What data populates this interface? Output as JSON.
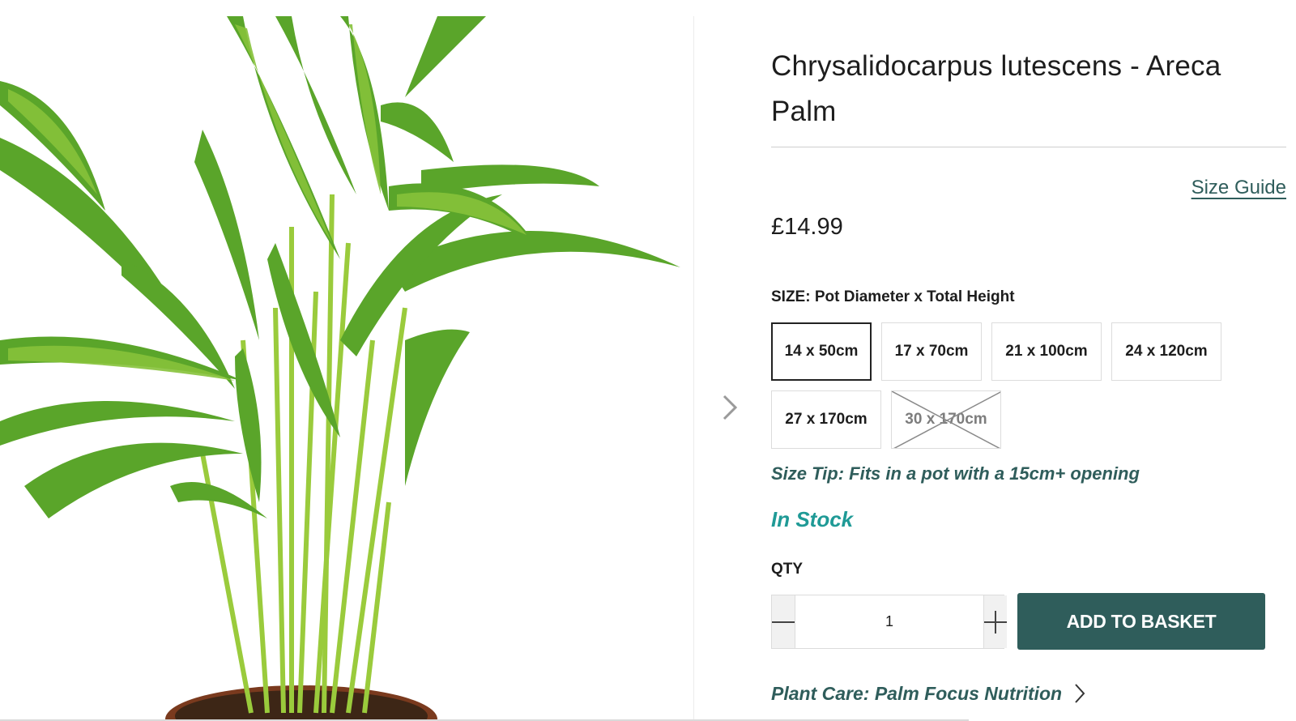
{
  "product": {
    "title": "Chrysalidocarpus lutescens - Areca Palm",
    "price": "£14.99",
    "size_guide_label": "Size Guide",
    "image_icon": "plant-photo"
  },
  "size": {
    "label": "SIZE: Pot Diameter x Total Height",
    "options": [
      {
        "label": "14 x 50cm",
        "state": "selected"
      },
      {
        "label": "17 x 70cm",
        "state": "available"
      },
      {
        "label": "21 x 100cm",
        "state": "available"
      },
      {
        "label": "24 x 120cm",
        "state": "available"
      },
      {
        "label": "27 x 170cm",
        "state": "available"
      },
      {
        "label": "30 x 170cm",
        "state": "unavailable"
      }
    ],
    "tip": "Size Tip: Fits in a pot with a 15cm+ opening"
  },
  "stock": {
    "status": "In Stock",
    "color": "#1f9a96"
  },
  "quantity": {
    "label": "QTY",
    "value": "1",
    "decrement_icon": "minus-icon",
    "increment_icon": "plus-icon"
  },
  "cart": {
    "add_label": "ADD TO BASKET",
    "button_color": "#2f5d5b"
  },
  "care": {
    "label": "Plant Care: Palm Focus Nutrition",
    "icon": "chevron-right-icon"
  },
  "gallery": {
    "next_icon": "chevron-right-icon"
  },
  "colors": {
    "accent": "#2f5d5b",
    "text": "#1d1d1d",
    "border": "#dcdcdc"
  }
}
